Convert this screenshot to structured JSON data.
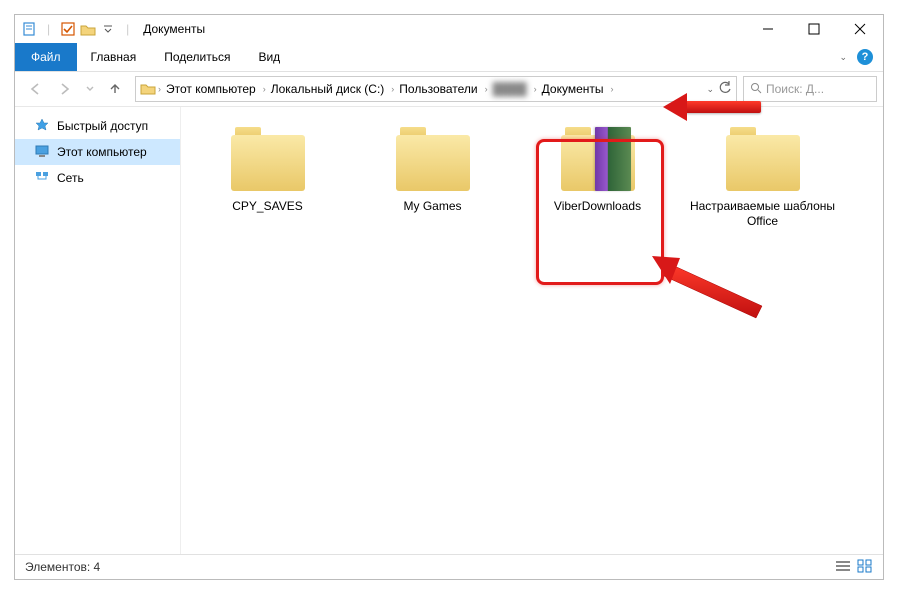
{
  "title": "Документы",
  "ribbon": {
    "file": "Файл",
    "home": "Главная",
    "share": "Поделиться",
    "view": "Вид"
  },
  "breadcrumbs": [
    "Этот компьютер",
    "Локальный диск (C:)",
    "Пользователи",
    "████",
    "Документы"
  ],
  "search_placeholder": "Поиск: Д...",
  "sidebar": [
    "Быстрый доступ",
    "Этот компьютер",
    "Сеть"
  ],
  "folders": [
    "CPY_SAVES",
    "My Games",
    "ViberDownloads",
    "Настраиваемые шаблоны Office"
  ],
  "status": "Элементов: 4"
}
